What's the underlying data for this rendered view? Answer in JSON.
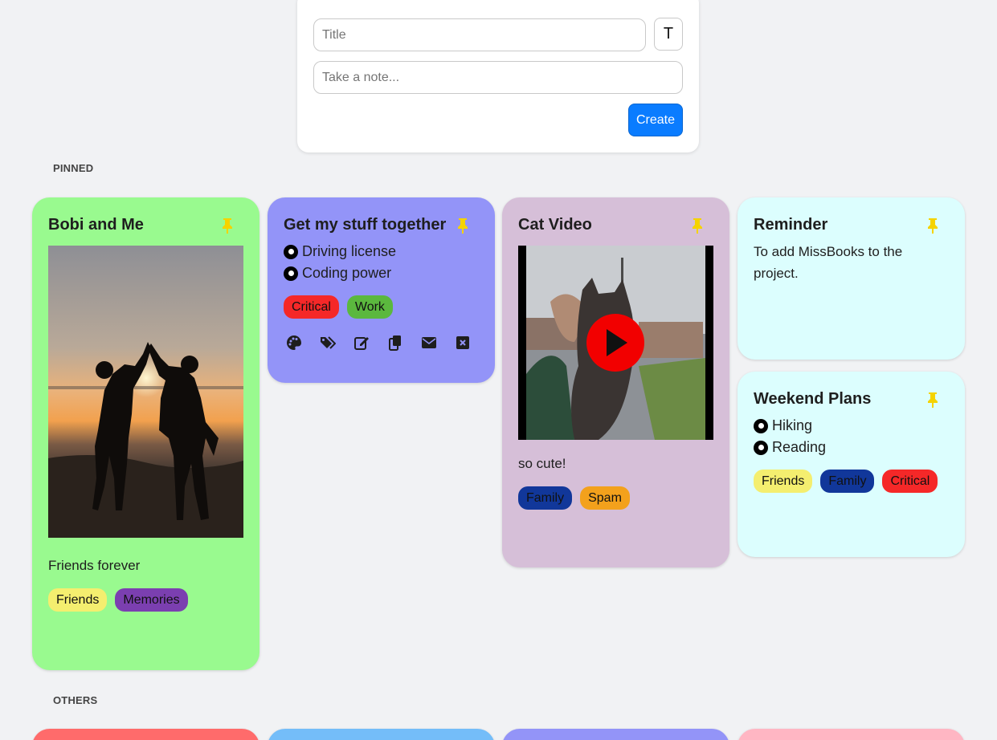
{
  "composer": {
    "title_placeholder": "Title",
    "note_placeholder": "Take a note...",
    "type_button": "T",
    "create_label": "Create"
  },
  "sections": {
    "pinned": "PINNED",
    "others": "OTHERS"
  },
  "colors": {
    "pin": "#f5d300",
    "green_card": "#99fa8f",
    "purple_card": "#9394f8",
    "mauve_card": "#d6bfd8",
    "cyan_card": "#dcfefe",
    "tag_friends": "#f4ee6f",
    "tag_memories": "#7b3fb0",
    "tag_critical": "#f52828",
    "tag_work": "#5bb83e",
    "tag_family": "#11379a",
    "tag_spam": "#f3a11c",
    "accent": "#0a7cff"
  },
  "notes": {
    "bobi": {
      "title": "Bobi and Me",
      "text": "Friends forever",
      "tags": [
        "Friends",
        "Memories"
      ],
      "image": "sunset-high-five-photo"
    },
    "stuff": {
      "title": "Get my stuff together",
      "todos": [
        "Driving license",
        "Coding power"
      ],
      "tags": [
        "Critical",
        "Work"
      ],
      "actions": [
        "palette-icon",
        "tags-icon",
        "edit-icon",
        "duplicate-icon",
        "email-icon",
        "delete-icon"
      ]
    },
    "cat": {
      "title": "Cat Video",
      "text": "so cute!",
      "tags": [
        "Family",
        "Spam"
      ],
      "video": "cat-video-thumbnail"
    },
    "reminder": {
      "title": "Reminder",
      "text": "To add MissBooks to the project."
    },
    "weekend": {
      "title": "Weekend Plans",
      "todos": [
        "Hiking",
        "Reading"
      ],
      "tags": [
        "Friends",
        "Family",
        "Critical"
      ]
    }
  },
  "others_cards": [
    "#ff6b6b",
    "#74bdf9",
    "#9394f8",
    "#ffb6c3"
  ]
}
